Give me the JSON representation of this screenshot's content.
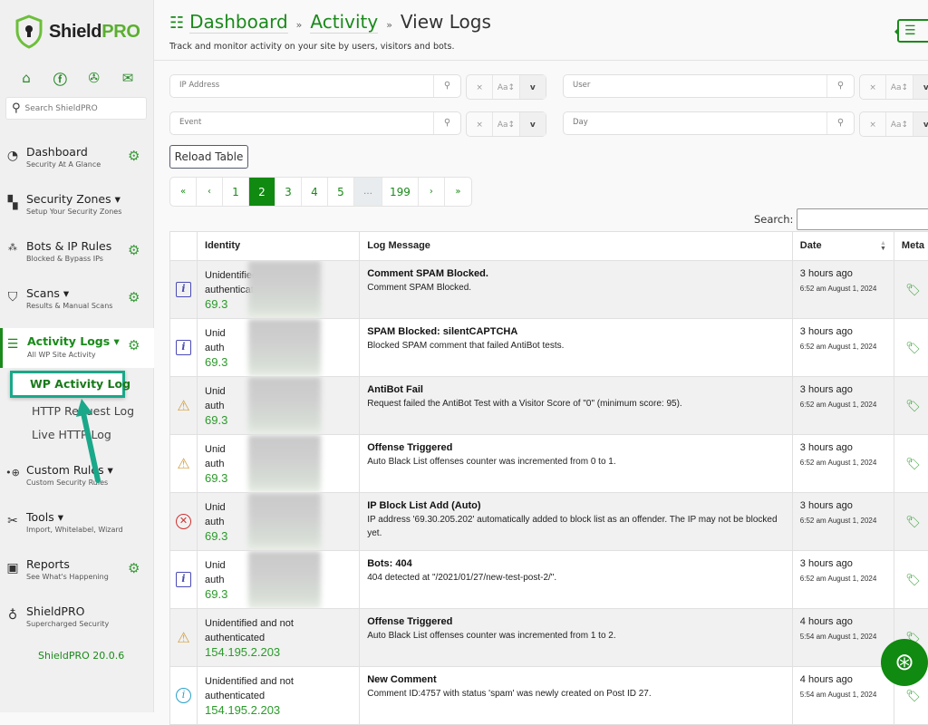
{
  "sidebar": {
    "brand_a": "Shield",
    "brand_b": "PRO",
    "social_icons": [
      "home-icon",
      "facebook-icon",
      "support-icon",
      "mail-icon"
    ],
    "search_placeholder": "Search ShieldPRO",
    "items": [
      {
        "title": "Dashboard",
        "subtitle": "Security At A Glance",
        "icon": "gauge-icon",
        "gear": true
      },
      {
        "title": "Security Zones ▾",
        "subtitle": "Setup Your Security Zones",
        "icon": "grid-icon",
        "gear": false
      },
      {
        "title": "Bots & IP Rules",
        "subtitle": "Blocked & Bypass IPs",
        "icon": "network-icon",
        "gear": true
      },
      {
        "title": "Scans ▾",
        "subtitle": "Results & Manual Scans",
        "icon": "shield-icon",
        "gear": true
      },
      {
        "title": "Activity Logs ▾",
        "subtitle": "All WP Site Activity",
        "icon": "activity-icon",
        "gear": true,
        "active": true
      },
      {
        "title": "Custom Rules ▾",
        "subtitle": "Custom Security Rules",
        "icon": "custom-rules-icon",
        "gear": false
      },
      {
        "title": "Tools ▾",
        "subtitle": "Import, Whitelabel, Wizard",
        "icon": "tools-icon",
        "gear": false
      },
      {
        "title": "Reports",
        "subtitle": "See What's Happening",
        "icon": "reports-icon",
        "gear": true
      },
      {
        "title": "ShieldPRO",
        "subtitle": "Supercharged Security",
        "icon": "award-icon",
        "gear": false
      }
    ],
    "subitems": [
      "WP Activity Log",
      "HTTP Request Log",
      "Live HTTP Log"
    ],
    "version": "ShieldPRO 20.0.6"
  },
  "header": {
    "crumb_1": "Dashboard",
    "crumb_2": "Activity",
    "crumb_3": "View Logs",
    "separator": "»",
    "tagline": "Track and monitor activity on your site by users, visitors and bots."
  },
  "filters": [
    {
      "placeholder": "IP Address"
    },
    {
      "placeholder": "User"
    },
    {
      "placeholder": "Event"
    },
    {
      "placeholder": "Day"
    }
  ],
  "filter_buttons": {
    "clear": "×",
    "case": "Aa↕",
    "toggle": "v"
  },
  "reload_label": "Reload Table",
  "pagination": {
    "items": [
      "«",
      "‹",
      "1",
      "2",
      "3",
      "4",
      "5",
      "…",
      "199",
      "›",
      "»"
    ],
    "current": "2"
  },
  "table": {
    "search_label": "Search:",
    "search_value": "",
    "columns": [
      "",
      "Identity",
      "Log Message",
      "Date",
      "Meta"
    ],
    "rows": [
      {
        "level": "info",
        "identity_1": "Unidentified and not",
        "identity_2": "authenticated",
        "ip": "69.3",
        "title": "Comment SPAM Blocked.",
        "body": "Comment SPAM Blocked.",
        "relative": "3 hours ago",
        "absolute": "6:52 am August 1, 2024"
      },
      {
        "level": "info",
        "identity_1": "Unid",
        "identity_2": "auth",
        "ip": "69.3",
        "title": "SPAM Blocked: silentCAPTCHA",
        "body": "Blocked SPAM comment that failed AntiBot tests.",
        "relative": "3 hours ago",
        "absolute": "6:52 am August 1, 2024"
      },
      {
        "level": "warning",
        "identity_1": "Unid",
        "identity_2": "auth",
        "ip": "69.3",
        "title": "AntiBot Fail",
        "body": "Request failed the AntiBot Test with a Visitor Score of \"0\" (minimum score: 95).",
        "relative": "3 hours ago",
        "absolute": "6:52 am August 1, 2024"
      },
      {
        "level": "warning",
        "identity_1": "Unid",
        "identity_2": "auth",
        "ip": "69.3",
        "title": "Offense Triggered",
        "body": "Auto Black List offenses counter was incremented from 0 to 1.",
        "relative": "3 hours ago",
        "absolute": "6:52 am August 1, 2024"
      },
      {
        "level": "error",
        "identity_1": "Unid",
        "identity_2": "auth",
        "ip": "69.3",
        "title": "IP Block List Add (Auto)",
        "body": "IP address '69.30.205.202' automatically added to block list as an offender. The IP may not be blocked yet.",
        "relative": "3 hours ago",
        "absolute": "6:52 am August 1, 2024"
      },
      {
        "level": "info",
        "identity_1": "Unid",
        "identity_2": "auth",
        "ip": "69.3",
        "title": "Bots: 404",
        "body": "404 detected at \"/2021/01/27/new-test-post-2/\".",
        "relative": "3 hours ago",
        "absolute": "6:52 am August 1, 2024"
      },
      {
        "level": "warning",
        "identity_1": "Unidentified and not",
        "identity_2": "authenticated",
        "ip": "154.195.2.203",
        "title": "Offense Triggered",
        "body": "Auto Black List offenses counter was incremented from 1 to 2.",
        "relative": "4 hours ago",
        "absolute": "5:54 am August 1, 2024"
      },
      {
        "level": "notice",
        "identity_1": "Unidentified and not",
        "identity_2": "authenticated",
        "ip": "154.195.2.203",
        "title": "New Comment",
        "body": "Comment ID:4757 with status 'spam' was newly created on Post ID 27.",
        "relative": "4 hours ago",
        "absolute": "5:54 am August 1, 2024"
      }
    ]
  },
  "colors": {
    "brand_green": "#1a8a1a",
    "highlight": "#1aa88a"
  }
}
